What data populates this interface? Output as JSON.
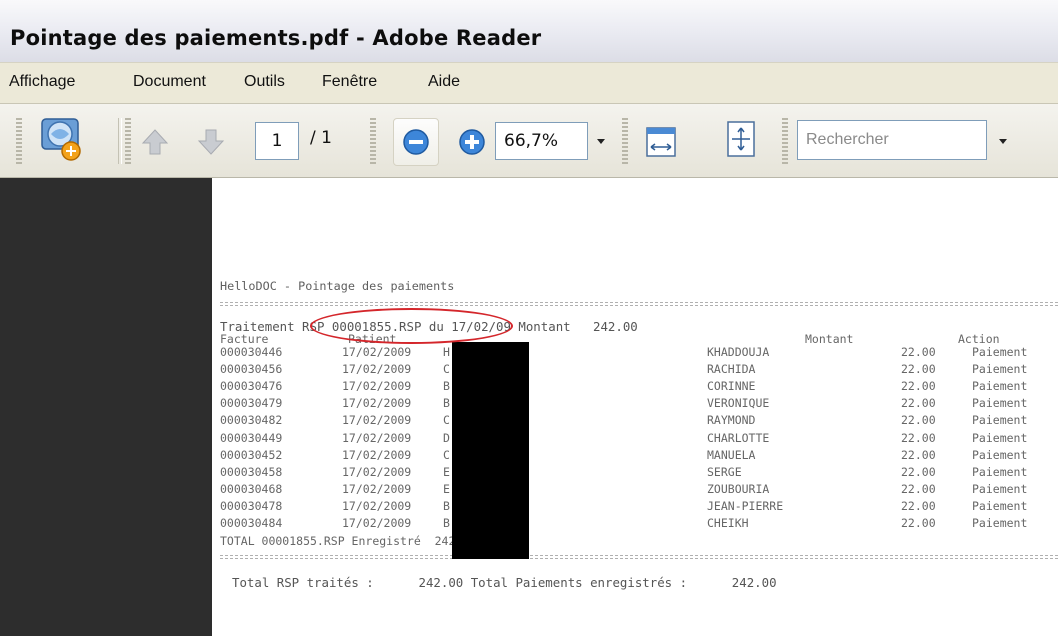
{
  "window": {
    "title": "Pointage des paiements.pdf - Adobe Reader"
  },
  "menu": [
    "Affichage",
    "Document",
    "Outils",
    "Fenêtre",
    "Aide"
  ],
  "toolbar": {
    "page_current": "1",
    "page_total": "/ 1",
    "zoom": "66,7%",
    "search_placeholder": "Rechercher"
  },
  "document": {
    "heading": "HelloDOC - Pointage des paiements",
    "treatment_line": "Traitement RSP 00001855.RSP du 17/02/09 Montant   242.00",
    "columns": {
      "facture": "Facture",
      "patient": "Patient",
      "montant": "Montant",
      "action": "Action"
    },
    "rows": [
      {
        "facture": "000030446",
        "date": "17/02/2009",
        "code": "H",
        "name": "KHADDOUJA",
        "montant": "22.00",
        "action": "Paiement"
      },
      {
        "facture": "000030456",
        "date": "17/02/2009",
        "code": "C",
        "name": "RACHIDA",
        "montant": "22.00",
        "action": "Paiement"
      },
      {
        "facture": "000030476",
        "date": "17/02/2009",
        "code": "B",
        "name": "CORINNE",
        "montant": "22.00",
        "action": "Paiement"
      },
      {
        "facture": "000030479",
        "date": "17/02/2009",
        "code": "B",
        "name": "VERONIQUE",
        "montant": "22.00",
        "action": "Paiement"
      },
      {
        "facture": "000030482",
        "date": "17/02/2009",
        "code": "C",
        "name": "RAYMOND",
        "montant": "22.00",
        "action": "Paiement"
      },
      {
        "facture": "000030449",
        "date": "17/02/2009",
        "code": "D",
        "name": "CHARLOTTE",
        "montant": "22.00",
        "action": "Paiement"
      },
      {
        "facture": "000030452",
        "date": "17/02/2009",
        "code": "C",
        "name": "MANUELA",
        "montant": "22.00",
        "action": "Paiement"
      },
      {
        "facture": "000030458",
        "date": "17/02/2009",
        "code": "E",
        "name": "SERGE",
        "montant": "22.00",
        "action": "Paiement"
      },
      {
        "facture": "000030468",
        "date": "17/02/2009",
        "code": "E",
        "name": "ZOUBOURIA",
        "montant": "22.00",
        "action": "Paiement"
      },
      {
        "facture": "000030478",
        "date": "17/02/2009",
        "code": "B",
        "name": "JEAN-PIERRE",
        "montant": "22.00",
        "action": "Paiement"
      },
      {
        "facture": "000030484",
        "date": "17/02/2009",
        "code": "B",
        "name": "CHEIKH",
        "montant": "22.00",
        "action": "Paiement"
      }
    ],
    "total_line": "TOTAL 00001855.RSP Enregistré  242.00",
    "summary_line": "Total RSP traités :      242.00 Total Paiements enregistrés :      242.00"
  },
  "colors": {
    "annotation_circle": "#d4262b",
    "nav_pane": "#2d2d2d"
  }
}
